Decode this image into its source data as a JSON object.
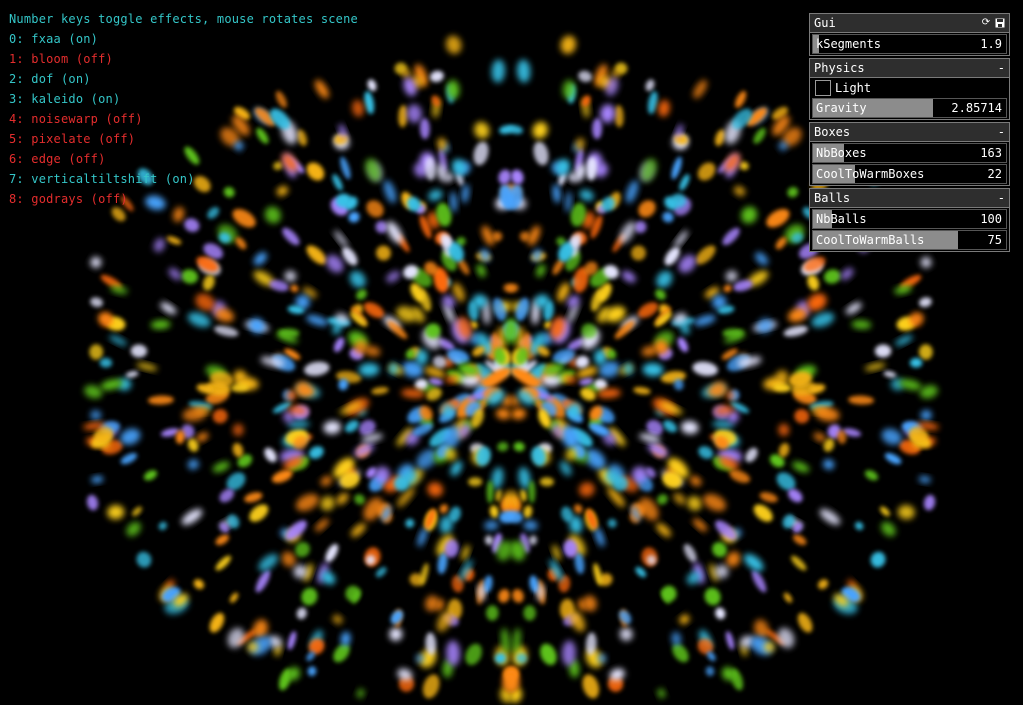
{
  "hud": {
    "title": "Number keys toggle effects, mouse rotates scene",
    "effects": [
      {
        "label": "0: fxaa (on)",
        "on": true
      },
      {
        "label": "1: bloom (off)",
        "on": false
      },
      {
        "label": "2: dof (on)",
        "on": true
      },
      {
        "label": "3: kaleido (on)",
        "on": true
      },
      {
        "label": "4: noisewarp (off)",
        "on": false
      },
      {
        "label": "5: pixelate (off)",
        "on": false
      },
      {
        "label": "6: edge (off)",
        "on": false
      },
      {
        "label": "7: verticaltiltshift (on)",
        "on": true
      },
      {
        "label": "8: godrays (off)",
        "on": false
      }
    ]
  },
  "gui": {
    "title": "Gui",
    "icons": [
      "refresh-icon",
      "save-icon"
    ],
    "top_slider": {
      "label": "kSegments",
      "value": "1.9",
      "fraction": 0.03
    },
    "groups": [
      {
        "name": "Physics",
        "collapse": "-",
        "toggle": {
          "label": "Light",
          "checked": false
        },
        "sliders": [
          {
            "label": "Gravity",
            "value": "2.85714",
            "fraction": 0.62
          }
        ]
      },
      {
        "name": "Boxes",
        "collapse": "-",
        "sliders": [
          {
            "label": "NbBoxes",
            "value": "163",
            "fraction": 0.16
          },
          {
            "label": "CoolToWarmBoxes",
            "value": "22",
            "fraction": 0.22
          }
        ]
      },
      {
        "name": "Balls",
        "collapse": "-",
        "sliders": [
          {
            "label": "NbBalls",
            "value": "100",
            "fraction": 0.1
          },
          {
            "label": "CoolToWarmBalls",
            "value": "75",
            "fraction": 0.75
          }
        ]
      }
    ]
  },
  "colors": {
    "on": "#34c6c8",
    "off": "#e42d2d",
    "particles": [
      "#ffd21a",
      "#ff8a12",
      "#f7b516",
      "#39c3e8",
      "#5ec51a",
      "#a985ff",
      "#4aa4ff",
      "#e6e6ff",
      "#ff6a10"
    ]
  }
}
